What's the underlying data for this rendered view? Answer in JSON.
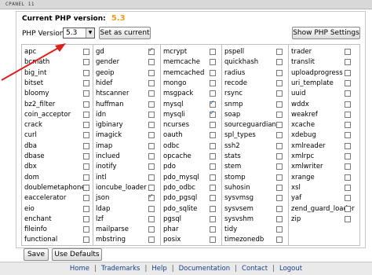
{
  "app": {
    "brand": "CPANEL 11"
  },
  "header": {
    "current_label": "Current PHP version:",
    "current_value": "5.3",
    "version_label": "PHP Version",
    "selected_version": "5.3",
    "set_current_label": "Set as current",
    "show_settings_label": "Show PHP Settings"
  },
  "extensions": [
    [
      {
        "name": "apc",
        "checked": false
      },
      {
        "name": "bcmath",
        "checked": false
      },
      {
        "name": "big_int",
        "checked": false
      },
      {
        "name": "bitset",
        "checked": false
      },
      {
        "name": "bloomy",
        "checked": false
      },
      {
        "name": "bz2_filter",
        "checked": false
      },
      {
        "name": "coin_acceptor",
        "checked": false
      },
      {
        "name": "crack",
        "checked": false
      },
      {
        "name": "curl",
        "checked": false
      },
      {
        "name": "dba",
        "checked": false
      },
      {
        "name": "dbase",
        "checked": false
      },
      {
        "name": "dbx",
        "checked": false
      },
      {
        "name": "dom",
        "checked": false
      },
      {
        "name": "doublemetaphone",
        "checked": false
      },
      {
        "name": "eaccelerator",
        "checked": false
      },
      {
        "name": "eio",
        "checked": false
      },
      {
        "name": "enchant",
        "checked": false
      },
      {
        "name": "fileinfo",
        "checked": false
      },
      {
        "name": "functional",
        "checked": false
      }
    ],
    [
      {
        "name": "gd",
        "checked": true
      },
      {
        "name": "gender",
        "checked": false
      },
      {
        "name": "geoip",
        "checked": false
      },
      {
        "name": "hidef",
        "checked": false
      },
      {
        "name": "htscanner",
        "checked": false
      },
      {
        "name": "huffman",
        "checked": false
      },
      {
        "name": "idn",
        "checked": false
      },
      {
        "name": "igbinary",
        "checked": false
      },
      {
        "name": "imagick",
        "checked": false
      },
      {
        "name": "imap",
        "checked": false
      },
      {
        "name": "inclued",
        "checked": false
      },
      {
        "name": "inotify",
        "checked": false
      },
      {
        "name": "intl",
        "checked": false
      },
      {
        "name": "ioncube_loader",
        "checked": false
      },
      {
        "name": "json",
        "checked": true
      },
      {
        "name": "ldap",
        "checked": false
      },
      {
        "name": "lzf",
        "checked": false
      },
      {
        "name": "mailparse",
        "checked": false
      },
      {
        "name": "mbstring",
        "checked": false
      }
    ],
    [
      {
        "name": "mcrypt",
        "checked": false
      },
      {
        "name": "memcache",
        "checked": false
      },
      {
        "name": "memcached",
        "checked": false
      },
      {
        "name": "mongo",
        "checked": false
      },
      {
        "name": "msgpack",
        "checked": false
      },
      {
        "name": "mysql",
        "checked": true
      },
      {
        "name": "mysqli",
        "checked": true
      },
      {
        "name": "ncurses",
        "checked": false
      },
      {
        "name": "oauth",
        "checked": false
      },
      {
        "name": "odbc",
        "checked": false
      },
      {
        "name": "opcache",
        "checked": false
      },
      {
        "name": "pdo",
        "checked": false
      },
      {
        "name": "pdo_mysql",
        "checked": false
      },
      {
        "name": "pdo_odbc",
        "checked": false
      },
      {
        "name": "pdo_pgsql",
        "checked": false
      },
      {
        "name": "pdo_sqlite",
        "checked": false
      },
      {
        "name": "pgsql",
        "checked": false
      },
      {
        "name": "phar",
        "checked": false
      },
      {
        "name": "posix",
        "checked": false
      }
    ],
    [
      {
        "name": "pspell",
        "checked": false
      },
      {
        "name": "quickhash",
        "checked": false
      },
      {
        "name": "radius",
        "checked": false
      },
      {
        "name": "recode",
        "checked": false
      },
      {
        "name": "rsync",
        "checked": false
      },
      {
        "name": "snmp",
        "checked": false
      },
      {
        "name": "soap",
        "checked": false
      },
      {
        "name": "sourceguardian",
        "checked": false
      },
      {
        "name": "spl_types",
        "checked": false
      },
      {
        "name": "ssh2",
        "checked": false
      },
      {
        "name": "stats",
        "checked": false
      },
      {
        "name": "stem",
        "checked": false
      },
      {
        "name": "stomp",
        "checked": false
      },
      {
        "name": "suhosin",
        "checked": false
      },
      {
        "name": "sysvmsg",
        "checked": false
      },
      {
        "name": "sysvsem",
        "checked": false
      },
      {
        "name": "sysvshm",
        "checked": false
      },
      {
        "name": "tidy",
        "checked": false
      },
      {
        "name": "timezonedb",
        "checked": false
      }
    ],
    [
      {
        "name": "trader",
        "checked": false
      },
      {
        "name": "translit",
        "checked": false
      },
      {
        "name": "uploadprogress",
        "checked": false
      },
      {
        "name": "uri_template",
        "checked": false
      },
      {
        "name": "uuid",
        "checked": false
      },
      {
        "name": "wddx",
        "checked": false
      },
      {
        "name": "weakref",
        "checked": false
      },
      {
        "name": "xcache",
        "checked": false
      },
      {
        "name": "xdebug",
        "checked": false
      },
      {
        "name": "xmlreader",
        "checked": false
      },
      {
        "name": "xmlrpc",
        "checked": false
      },
      {
        "name": "xmlwriter",
        "checked": false
      },
      {
        "name": "xrange",
        "checked": false
      },
      {
        "name": "xsl",
        "checked": false
      },
      {
        "name": "yaf",
        "checked": false
      },
      {
        "name": "zend_guard_loader",
        "checked": false
      },
      {
        "name": "zip",
        "checked": false
      }
    ]
  ],
  "actions": {
    "save_label": "Save",
    "defaults_label": "Use Defaults"
  },
  "footer": {
    "links": [
      "Home",
      "Trademarks",
      "Help",
      "Documentation",
      "Contact",
      "Logout"
    ]
  },
  "colors": {
    "version_accent": "#f39c12",
    "annotation_arrow": "#e0201c",
    "link": "#1a3d8f"
  }
}
